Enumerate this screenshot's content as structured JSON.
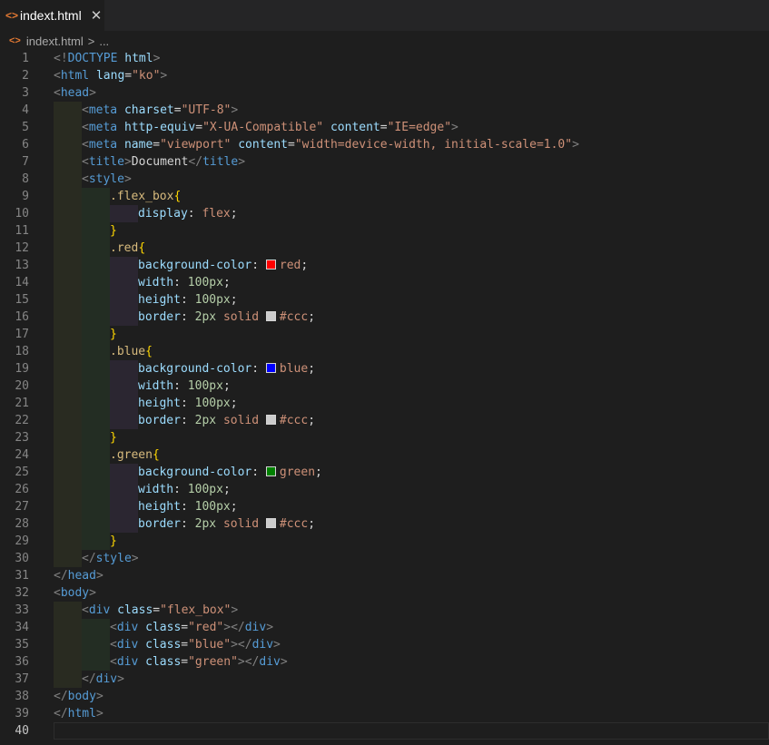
{
  "tab": {
    "icon": "html-brackets-icon",
    "title": "indext.html",
    "close": "✕"
  },
  "breadcrumb": {
    "file": "indext.html",
    "sep": ">",
    "more": "..."
  },
  "editor": {
    "current_line": 40,
    "lines": [
      {
        "n": "1",
        "g": 0,
        "t": [
          [
            "br",
            "<!"
          ],
          [
            "tag",
            "DOCTYPE"
          ],
          [
            "txt",
            " "
          ],
          [
            "attr",
            "html"
          ],
          [
            "br",
            ">"
          ]
        ]
      },
      {
        "n": "2",
        "g": 0,
        "t": [
          [
            "br",
            "<"
          ],
          [
            "tag",
            "html"
          ],
          [
            "txt",
            " "
          ],
          [
            "attr",
            "lang"
          ],
          [
            "txt",
            "="
          ],
          [
            "str",
            "\"ko\""
          ],
          [
            "br",
            ">"
          ]
        ]
      },
      {
        "n": "3",
        "g": 0,
        "t": [
          [
            "br",
            "<"
          ],
          [
            "tag",
            "head"
          ],
          [
            "br",
            ">"
          ]
        ]
      },
      {
        "n": "4",
        "g": 1,
        "t": [
          [
            "br",
            "<"
          ],
          [
            "tag",
            "meta"
          ],
          [
            "txt",
            " "
          ],
          [
            "attr",
            "charset"
          ],
          [
            "txt",
            "="
          ],
          [
            "str",
            "\"UTF-8\""
          ],
          [
            "br",
            ">"
          ]
        ]
      },
      {
        "n": "5",
        "g": 1,
        "t": [
          [
            "br",
            "<"
          ],
          [
            "tag",
            "meta"
          ],
          [
            "txt",
            " "
          ],
          [
            "attr",
            "http-equiv"
          ],
          [
            "txt",
            "="
          ],
          [
            "str",
            "\"X-UA-Compatible\""
          ],
          [
            "txt",
            " "
          ],
          [
            "attr",
            "content"
          ],
          [
            "txt",
            "="
          ],
          [
            "str",
            "\"IE=edge\""
          ],
          [
            "br",
            ">"
          ]
        ]
      },
      {
        "n": "6",
        "g": 1,
        "t": [
          [
            "br",
            "<"
          ],
          [
            "tag",
            "meta"
          ],
          [
            "txt",
            " "
          ],
          [
            "attr",
            "name"
          ],
          [
            "txt",
            "="
          ],
          [
            "str",
            "\"viewport\""
          ],
          [
            "txt",
            " "
          ],
          [
            "attr",
            "content"
          ],
          [
            "txt",
            "="
          ],
          [
            "str",
            "\"width=device-width, initial-scale=1.0\""
          ],
          [
            "br",
            ">"
          ]
        ]
      },
      {
        "n": "7",
        "g": 1,
        "t": [
          [
            "br",
            "<"
          ],
          [
            "tag",
            "title"
          ],
          [
            "br",
            ">"
          ],
          [
            "txt",
            "Document"
          ],
          [
            "br",
            "</"
          ],
          [
            "tag",
            "title"
          ],
          [
            "br",
            ">"
          ]
        ]
      },
      {
        "n": "8",
        "g": 1,
        "t": [
          [
            "br",
            "<"
          ],
          [
            "tag",
            "style"
          ],
          [
            "br",
            ">"
          ]
        ]
      },
      {
        "n": "9",
        "g": 2,
        "t": [
          [
            "sel",
            ".flex_box"
          ],
          [
            "brace",
            "{"
          ]
        ]
      },
      {
        "n": "10",
        "g": 3,
        "t": [
          [
            "prop",
            "display"
          ],
          [
            "txt",
            ": "
          ],
          [
            "val",
            "flex"
          ],
          [
            "txt",
            ";"
          ]
        ]
      },
      {
        "n": "11",
        "g": 2,
        "t": [
          [
            "brace",
            "}"
          ]
        ]
      },
      {
        "n": "12",
        "g": 2,
        "t": [
          [
            "sel",
            ".red"
          ],
          [
            "brace",
            "{"
          ]
        ]
      },
      {
        "n": "13",
        "g": 3,
        "t": [
          [
            "prop",
            "background-color"
          ],
          [
            "txt",
            ": "
          ],
          [
            "sw",
            "#ff0000"
          ],
          [
            "val",
            "red"
          ],
          [
            "txt",
            ";"
          ]
        ]
      },
      {
        "n": "14",
        "g": 3,
        "t": [
          [
            "prop",
            "width"
          ],
          [
            "txt",
            ": "
          ],
          [
            "num",
            "100px"
          ],
          [
            "txt",
            ";"
          ]
        ]
      },
      {
        "n": "15",
        "g": 3,
        "t": [
          [
            "prop",
            "height"
          ],
          [
            "txt",
            ": "
          ],
          [
            "num",
            "100px"
          ],
          [
            "txt",
            ";"
          ]
        ]
      },
      {
        "n": "16",
        "g": 3,
        "t": [
          [
            "prop",
            "border"
          ],
          [
            "txt",
            ": "
          ],
          [
            "num",
            "2px"
          ],
          [
            "txt",
            " "
          ],
          [
            "val",
            "solid"
          ],
          [
            "txt",
            " "
          ],
          [
            "sw",
            "#cccccc"
          ],
          [
            "val",
            "#ccc"
          ],
          [
            "txt",
            ";"
          ]
        ]
      },
      {
        "n": "17",
        "g": 2,
        "t": [
          [
            "brace",
            "}"
          ]
        ]
      },
      {
        "n": "18",
        "g": 2,
        "t": [
          [
            "sel",
            ".blue"
          ],
          [
            "brace",
            "{"
          ]
        ]
      },
      {
        "n": "19",
        "g": 3,
        "t": [
          [
            "prop",
            "background-color"
          ],
          [
            "txt",
            ": "
          ],
          [
            "sw",
            "#0000ff"
          ],
          [
            "val",
            "blue"
          ],
          [
            "txt",
            ";"
          ]
        ]
      },
      {
        "n": "20",
        "g": 3,
        "t": [
          [
            "prop",
            "width"
          ],
          [
            "txt",
            ": "
          ],
          [
            "num",
            "100px"
          ],
          [
            "txt",
            ";"
          ]
        ]
      },
      {
        "n": "21",
        "g": 3,
        "t": [
          [
            "prop",
            "height"
          ],
          [
            "txt",
            ": "
          ],
          [
            "num",
            "100px"
          ],
          [
            "txt",
            ";"
          ]
        ]
      },
      {
        "n": "22",
        "g": 3,
        "t": [
          [
            "prop",
            "border"
          ],
          [
            "txt",
            ": "
          ],
          [
            "num",
            "2px"
          ],
          [
            "txt",
            " "
          ],
          [
            "val",
            "solid"
          ],
          [
            "txt",
            " "
          ],
          [
            "sw",
            "#cccccc"
          ],
          [
            "val",
            "#ccc"
          ],
          [
            "txt",
            ";"
          ]
        ]
      },
      {
        "n": "23",
        "g": 2,
        "t": [
          [
            "brace",
            "}"
          ]
        ]
      },
      {
        "n": "24",
        "g": 2,
        "t": [
          [
            "sel",
            ".green"
          ],
          [
            "brace",
            "{"
          ]
        ]
      },
      {
        "n": "25",
        "g": 3,
        "t": [
          [
            "prop",
            "background-color"
          ],
          [
            "txt",
            ": "
          ],
          [
            "sw",
            "#008000"
          ],
          [
            "val",
            "green"
          ],
          [
            "txt",
            ";"
          ]
        ]
      },
      {
        "n": "26",
        "g": 3,
        "t": [
          [
            "prop",
            "width"
          ],
          [
            "txt",
            ": "
          ],
          [
            "num",
            "100px"
          ],
          [
            "txt",
            ";"
          ]
        ]
      },
      {
        "n": "27",
        "g": 3,
        "t": [
          [
            "prop",
            "height"
          ],
          [
            "txt",
            ": "
          ],
          [
            "num",
            "100px"
          ],
          [
            "txt",
            ";"
          ]
        ]
      },
      {
        "n": "28",
        "g": 3,
        "t": [
          [
            "prop",
            "border"
          ],
          [
            "txt",
            ": "
          ],
          [
            "num",
            "2px"
          ],
          [
            "txt",
            " "
          ],
          [
            "val",
            "solid"
          ],
          [
            "txt",
            " "
          ],
          [
            "sw",
            "#cccccc"
          ],
          [
            "val",
            "#ccc"
          ],
          [
            "txt",
            ";"
          ]
        ]
      },
      {
        "n": "29",
        "g": 2,
        "t": [
          [
            "brace",
            "}"
          ]
        ]
      },
      {
        "n": "30",
        "g": 1,
        "t": [
          [
            "br",
            "</"
          ],
          [
            "tag",
            "style"
          ],
          [
            "br",
            ">"
          ]
        ]
      },
      {
        "n": "31",
        "g": 0,
        "t": [
          [
            "br",
            "</"
          ],
          [
            "tag",
            "head"
          ],
          [
            "br",
            ">"
          ]
        ]
      },
      {
        "n": "32",
        "g": 0,
        "t": [
          [
            "br",
            "<"
          ],
          [
            "tag",
            "body"
          ],
          [
            "br",
            ">"
          ]
        ]
      },
      {
        "n": "33",
        "g": 1,
        "t": [
          [
            "br",
            "<"
          ],
          [
            "tag",
            "div"
          ],
          [
            "txt",
            " "
          ],
          [
            "attr",
            "class"
          ],
          [
            "txt",
            "="
          ],
          [
            "str",
            "\"flex_box\""
          ],
          [
            "br",
            ">"
          ]
        ]
      },
      {
        "n": "34",
        "g": 2,
        "t": [
          [
            "br",
            "<"
          ],
          [
            "tag",
            "div"
          ],
          [
            "txt",
            " "
          ],
          [
            "attr",
            "class"
          ],
          [
            "txt",
            "="
          ],
          [
            "str",
            "\"red\""
          ],
          [
            "br",
            "></"
          ],
          [
            "tag",
            "div"
          ],
          [
            "br",
            ">"
          ]
        ]
      },
      {
        "n": "35",
        "g": 2,
        "t": [
          [
            "br",
            "<"
          ],
          [
            "tag",
            "div"
          ],
          [
            "txt",
            " "
          ],
          [
            "attr",
            "class"
          ],
          [
            "txt",
            "="
          ],
          [
            "str",
            "\"blue\""
          ],
          [
            "br",
            "></"
          ],
          [
            "tag",
            "div"
          ],
          [
            "br",
            ">"
          ]
        ]
      },
      {
        "n": "36",
        "g": 2,
        "t": [
          [
            "br",
            "<"
          ],
          [
            "tag",
            "div"
          ],
          [
            "txt",
            " "
          ],
          [
            "attr",
            "class"
          ],
          [
            "txt",
            "="
          ],
          [
            "str",
            "\"green\""
          ],
          [
            "br",
            "></"
          ],
          [
            "tag",
            "div"
          ],
          [
            "br",
            ">"
          ]
        ]
      },
      {
        "n": "37",
        "g": 1,
        "t": [
          [
            "br",
            "</"
          ],
          [
            "tag",
            "div"
          ],
          [
            "br",
            ">"
          ]
        ]
      },
      {
        "n": "38",
        "g": 0,
        "t": [
          [
            "br",
            "</"
          ],
          [
            "tag",
            "body"
          ],
          [
            "br",
            ">"
          ]
        ]
      },
      {
        "n": "39",
        "g": 0,
        "t": [
          [
            "br",
            "</"
          ],
          [
            "tag",
            "html"
          ],
          [
            "br",
            ">"
          ]
        ]
      },
      {
        "n": "40",
        "g": 0,
        "t": []
      }
    ]
  }
}
